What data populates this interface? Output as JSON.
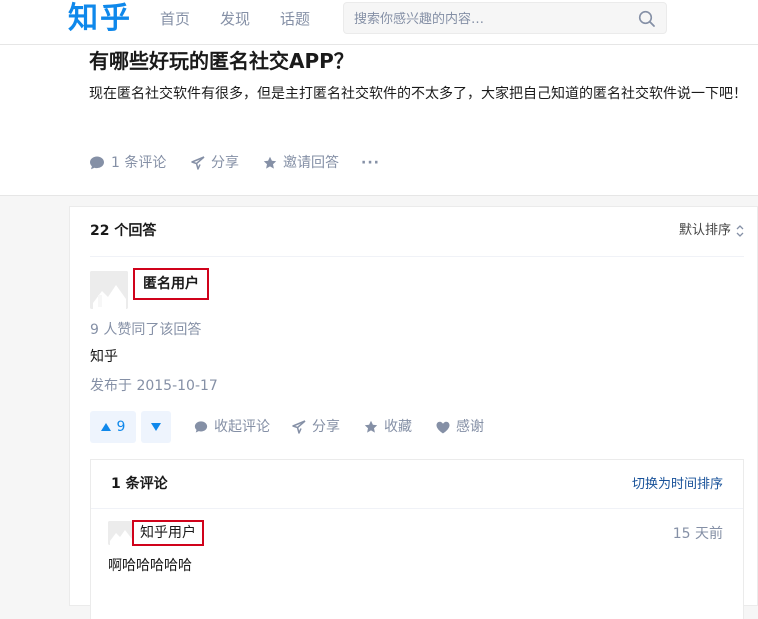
{
  "nav": {
    "logo": "知乎",
    "items": [
      "首页",
      "发现",
      "话题"
    ],
    "search_placeholder": "搜索你感兴趣的内容…"
  },
  "question": {
    "title": "有哪些好玩的匿名社交APP？",
    "description": "现在匿名社交软件有很多，但是主打匿名社交软件的不太多了，大家把自己知道的匿名社交软件说一下吧！",
    "actions": {
      "comments": "1 条评论",
      "share": "分享",
      "invite": "邀请回答",
      "more": "···"
    }
  },
  "answers": {
    "count_label": "22 个回答",
    "sort_label": "默认排序",
    "first": {
      "author": "匿名用户",
      "vote_summary": "9 人赞同了该回答",
      "content": "知乎",
      "published": "发布于 2015-10-17",
      "upvotes": "9",
      "actions": {
        "collapse_comments": "收起评论",
        "share": "分享",
        "favorite": "收藏",
        "thanks": "感谢"
      },
      "comments": {
        "count_label": "1 条评论",
        "sort_toggle": "切换为时间排序",
        "items": [
          {
            "author": "知乎用户",
            "time": "15 天前",
            "content": "啊哈哈哈哈哈"
          }
        ]
      }
    }
  },
  "colors": {
    "brand": "#0f88eb",
    "muted": "#8590a6",
    "link": "#175199",
    "highlight_box": "#d0021b"
  }
}
